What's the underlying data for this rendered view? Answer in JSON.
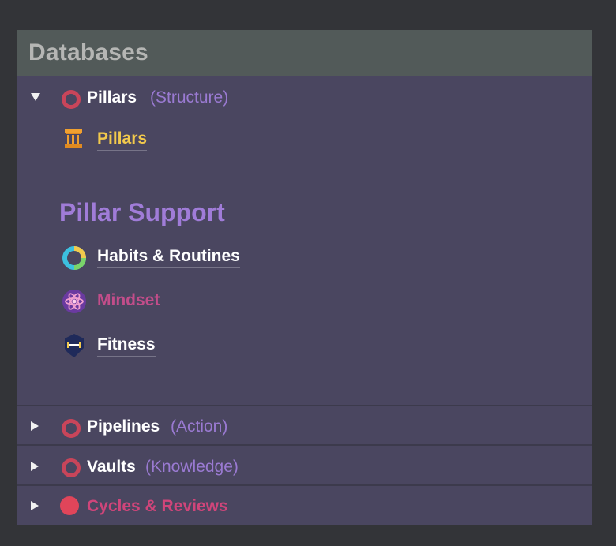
{
  "panel": {
    "title": "Databases"
  },
  "groups": [
    {
      "name": "Pillars",
      "subtitle": "(Structure)",
      "expanded": true,
      "icon": "circle-outline-icon",
      "color": "#c8455a"
    },
    {
      "name": "Pipelines",
      "subtitle": "(Action)",
      "expanded": false,
      "icon": "circle-outline-icon",
      "color": "#c8455a"
    },
    {
      "name": "Vaults",
      "subtitle": "(Knowledge)",
      "expanded": false,
      "icon": "circle-outline-icon",
      "color": "#c8455a"
    },
    {
      "name": "Cycles & Reviews",
      "expanded": false,
      "icon": "circle-filled-icon",
      "color": "#e0455a"
    }
  ],
  "pillars_content": {
    "main_link": {
      "label": "Pillars",
      "icon": "column-icon",
      "color": "#f2c94c"
    },
    "section_heading": "Pillar Support",
    "support_links": [
      {
        "label": "Habits & Routines",
        "icon": "ring-gradient-icon",
        "color": "#ffffff"
      },
      {
        "label": "Mindset",
        "icon": "atom-icon",
        "color": "#c24d8a"
      },
      {
        "label": "Fitness",
        "icon": "dumbbell-icon",
        "color": "#ffffff"
      }
    ]
  }
}
